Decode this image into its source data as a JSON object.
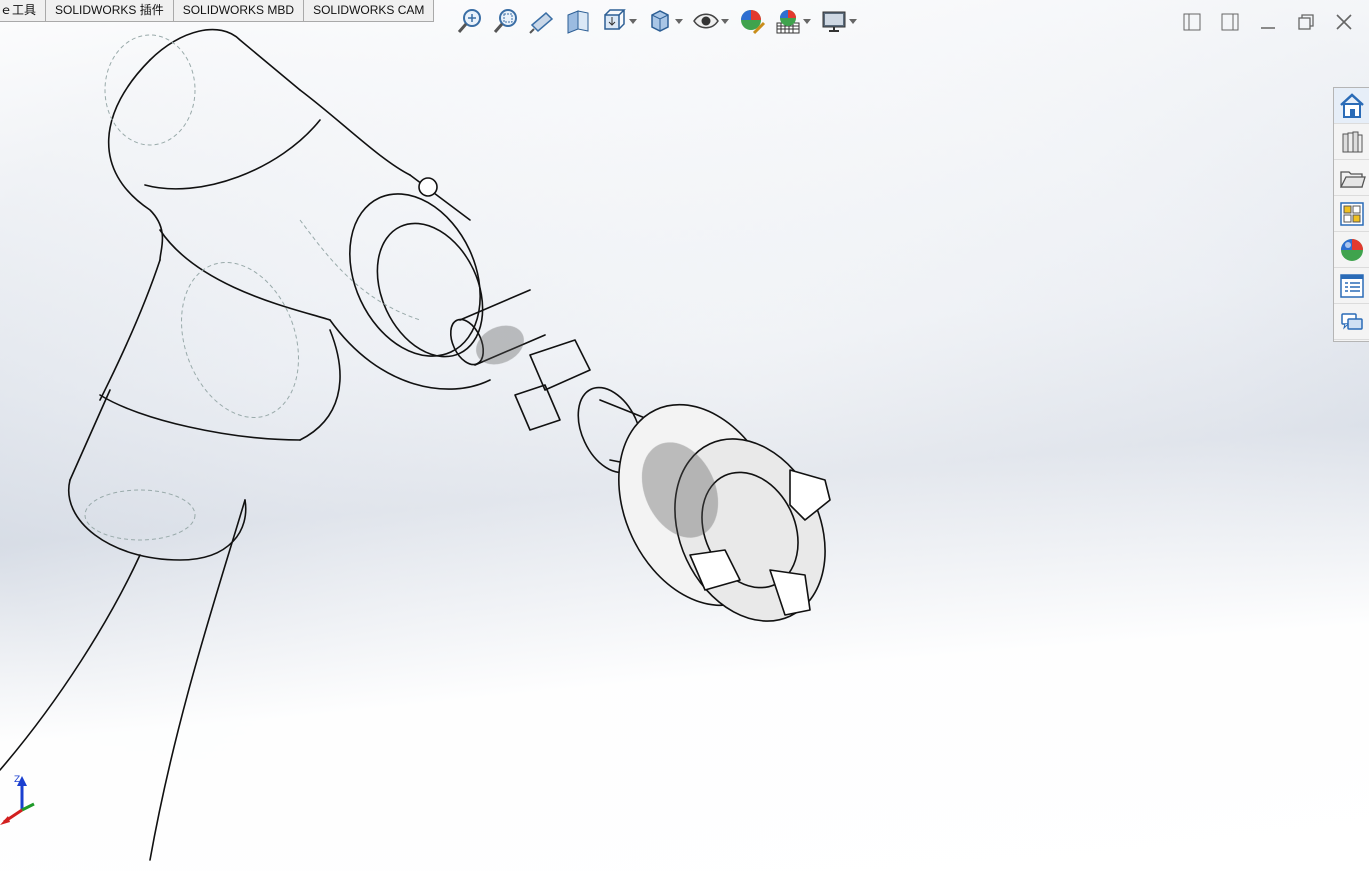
{
  "tabs": [
    {
      "label": "ｅ工具"
    },
    {
      "label": "SOLIDWORKS 插件"
    },
    {
      "label": "SOLIDWORKS MBD"
    },
    {
      "label": "SOLIDWORKS CAM"
    }
  ],
  "view_toolbar": {
    "buttons": [
      {
        "icon": "zoom-to-fit-icon"
      },
      {
        "icon": "zoom-to-area-icon"
      },
      {
        "icon": "previous-view-icon"
      },
      {
        "icon": "section-view-icon"
      },
      {
        "icon": "view-orientation-icon",
        "has_menu": true
      },
      {
        "icon": "display-style-icon",
        "has_menu": true
      },
      {
        "icon": "hide-show-items-icon",
        "has_menu": true
      },
      {
        "icon": "edit-appearance-icon"
      },
      {
        "icon": "apply-scene-icon",
        "has_menu": true
      },
      {
        "icon": "view-settings-icon",
        "has_menu": true
      }
    ]
  },
  "window_controls": [
    "tile-left-icon",
    "tile-right-icon",
    "minimize-icon",
    "restore-icon",
    "close-icon"
  ],
  "task_pane": [
    "solidworks-resources-icon",
    "design-library-icon",
    "file-explorer-icon",
    "view-palette-icon",
    "appearances-scenes-icon",
    "custom-properties-icon",
    "forum-icon"
  ],
  "triad": {
    "z_label": "Z",
    "colors": {
      "z": "#1a3fd0",
      "y": "#1f9a2a",
      "x": "#d21f1f"
    }
  }
}
